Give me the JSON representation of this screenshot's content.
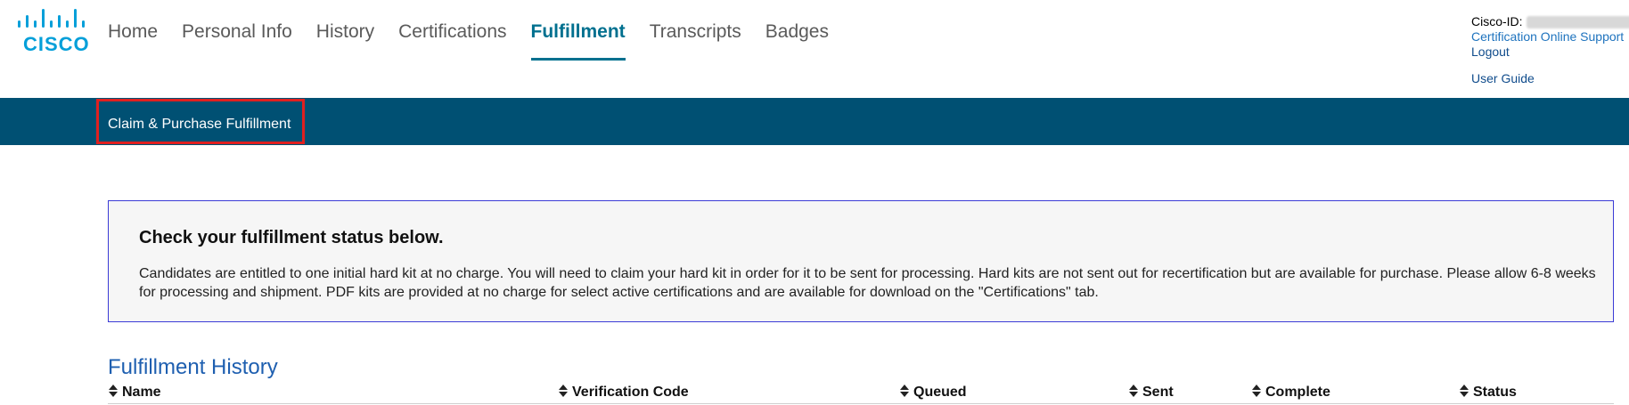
{
  "brand": {
    "logo_text": "CISCO",
    "accent": "#049fd9"
  },
  "nav": {
    "items": [
      {
        "label": "Home",
        "active": false
      },
      {
        "label": "Personal Info",
        "active": false
      },
      {
        "label": "History",
        "active": false
      },
      {
        "label": "Certifications",
        "active": false
      },
      {
        "label": "Fulfillment",
        "active": true
      },
      {
        "label": "Transcripts",
        "active": false
      },
      {
        "label": "Badges",
        "active": false
      }
    ],
    "active_color": "#00708f"
  },
  "account": {
    "id_label": "Cisco-ID:",
    "support_link": "Certification Online Support",
    "logout_link": "Logout",
    "guide_link": "User Guide"
  },
  "subnav": {
    "item_label": "Claim & Purchase Fulfillment",
    "bar_color": "#005073",
    "highlight_color": "#e02020"
  },
  "notice": {
    "heading": "Check your fulfillment status below.",
    "body": "Candidates are entitled to one initial hard kit at no charge. You will need to claim your hard kit in order for it to be sent for processing. Hard kits are not sent out for recertification but are available for purchase. Please allow 6-8 weeks for processing and shipment. PDF kits are provided at no charge for select active certifications and are available for download on the \"Certifications\" tab."
  },
  "history": {
    "title": "Fulfillment History",
    "columns": [
      "Name",
      "Verification Code",
      "Queued",
      "Sent",
      "Complete",
      "Status"
    ]
  }
}
